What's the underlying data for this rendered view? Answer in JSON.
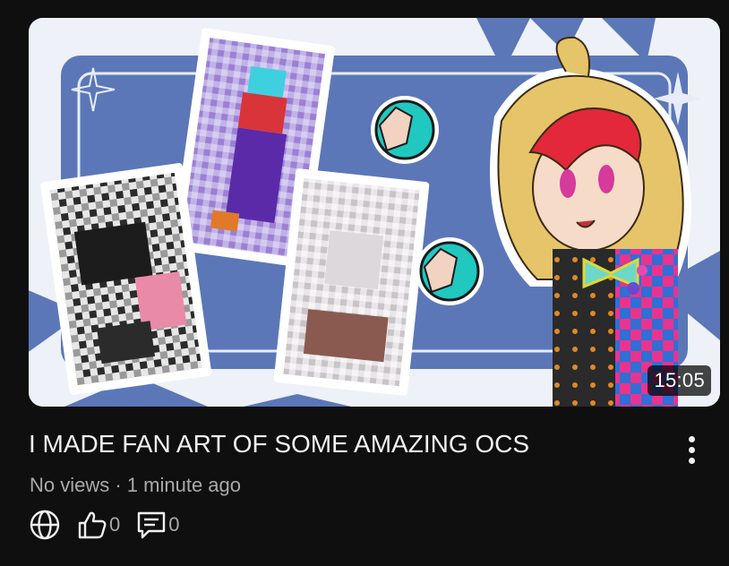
{
  "video": {
    "duration": "15:05",
    "title": "I MADE FAN ART OF SOME AMAZING OCS",
    "meta": "No views · 1 minute ago",
    "likes": "0",
    "comments": "0"
  },
  "icons": {
    "visibility": "globe-icon",
    "like": "thumbs-up-icon",
    "comment": "comment-icon",
    "more": "more-vertical-icon"
  },
  "colors": {
    "background": "#0f0f0f",
    "title": "#f1f1f1",
    "meta": "#aaaaaa",
    "thumbnail_blue": "#5b77b8"
  }
}
